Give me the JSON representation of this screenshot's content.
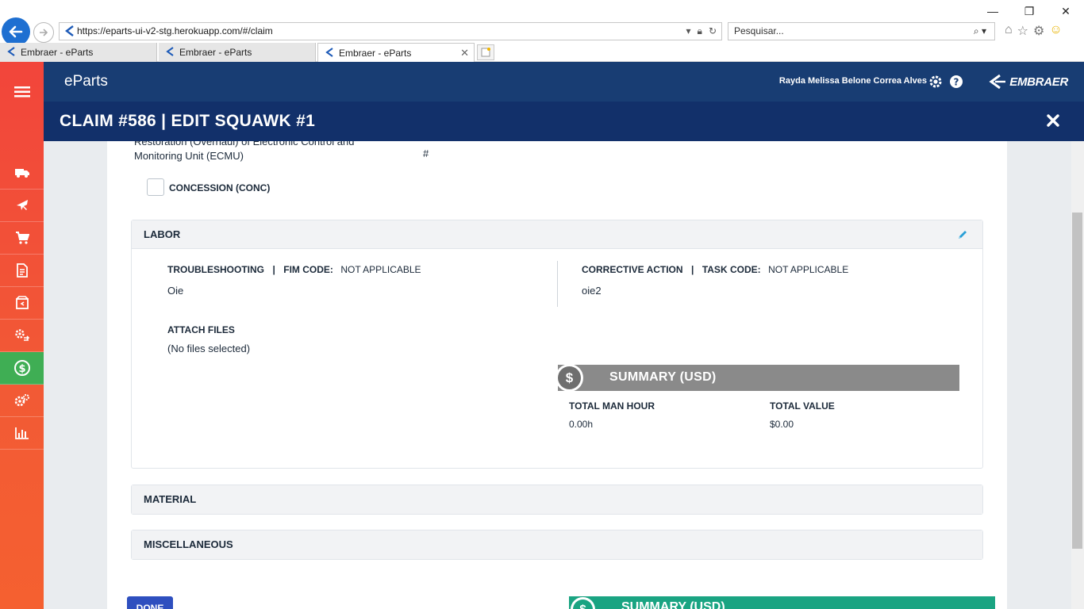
{
  "browser": {
    "url": "https://eparts-ui-v2-stg.herokuapp.com/#/claim",
    "search_placeholder": "Pesquisar...",
    "tabs": [
      {
        "label": "Embraer - eParts"
      },
      {
        "label": "Embraer - eParts"
      },
      {
        "label": "Embraer - eParts"
      }
    ]
  },
  "app": {
    "brand": "eParts",
    "user_name": "Rayda Melissa Belone Correa Alves",
    "logo_text": "EMBRAER",
    "sidebar_icons": [
      "truck-icon",
      "plane-icon",
      "cart-icon",
      "document-icon",
      "package-return-icon",
      "gear-swap-icon",
      "dollar-icon",
      "settings-icon",
      "bar-chart-icon"
    ]
  },
  "modal": {
    "title": "CLAIM #586 | EDIT SQUAWK #1",
    "part_desc_line1": "Restoration (Overhaul) of Electronic Control and",
    "part_desc_line2": "Monitoring Unit (ECMU)",
    "part_hash": "#",
    "concession_label": "CONCESSION (CONC)",
    "labor": {
      "title": "LABOR",
      "troubleshooting_label": "TROUBLESHOOTING",
      "separator": "|",
      "fim_code_label": "FIM CODE:",
      "fim_code_value": "NOT APPLICABLE",
      "troubleshooting_value": "Oie",
      "corrective_label": "CORRECTIVE ACTION",
      "task_code_label": "TASK CODE:",
      "task_code_value": "NOT APPLICABLE",
      "corrective_value": "oie2",
      "attach_label": "ATTACH FILES",
      "attach_value": "(No files selected)",
      "summary_title": "SUMMARY (USD)",
      "summary_icon": "$",
      "total_man_hour_label": "TOTAL MAN HOUR",
      "total_man_hour_value": "0.00h",
      "total_value_label": "TOTAL VALUE",
      "total_value_value": "$0.00"
    },
    "material_title": "MATERIAL",
    "misc_title": "MISCELLANEOUS",
    "done_label": "DONE",
    "footer_summary_title": "SUMMARY (USD)"
  },
  "colors": {
    "app_bar": "#183d73",
    "modal_header": "#12306a",
    "sidebar": "#f2453b",
    "sidebar_active": "#3fae54",
    "summary_gray": "#8a8a8a",
    "summary_green": "#1aa482",
    "done_button": "#2e4fbf",
    "pencil": "#2a9fd6"
  }
}
